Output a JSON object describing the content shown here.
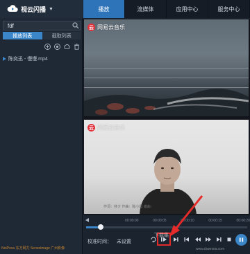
{
  "app": {
    "name": "视云闪播",
    "menu_caret": "▼"
  },
  "search": {
    "value": "fdf"
  },
  "left_tabs": [
    {
      "label": "播放列表"
    },
    {
      "label": "截取列表"
    }
  ],
  "playlist": {
    "items": [
      {
        "label": "陈奕迅 - 慢慢.mp4"
      }
    ]
  },
  "footer": {
    "text": "NetPosa 东方网力 Senseimage 广州影像"
  },
  "topnav": {
    "tabs": [
      {
        "label": "播放"
      },
      {
        "label": "流媒体"
      },
      {
        "label": "应用中心"
      },
      {
        "label": "服务中心"
      }
    ]
  },
  "video": {
    "watermark": "网易云音乐",
    "watermark_glyph": "云",
    "subtitle": "作词：林夕 作曲：陈小霞 编曲："
  },
  "controls": {
    "timeline_times": [
      "00:00:00",
      "00:00:05",
      "00:00:10",
      "00:00:15",
      "00:00:20"
    ],
    "progress": 0.09,
    "time_label": "校准时间：",
    "time_value": "未设置"
  },
  "overlay": {
    "brand": "下载集",
    "url": "www.downxia.com"
  },
  "colors": {
    "accent": "#3a86c8",
    "highlight": "#e52a2a",
    "netease": "#e0313b"
  }
}
